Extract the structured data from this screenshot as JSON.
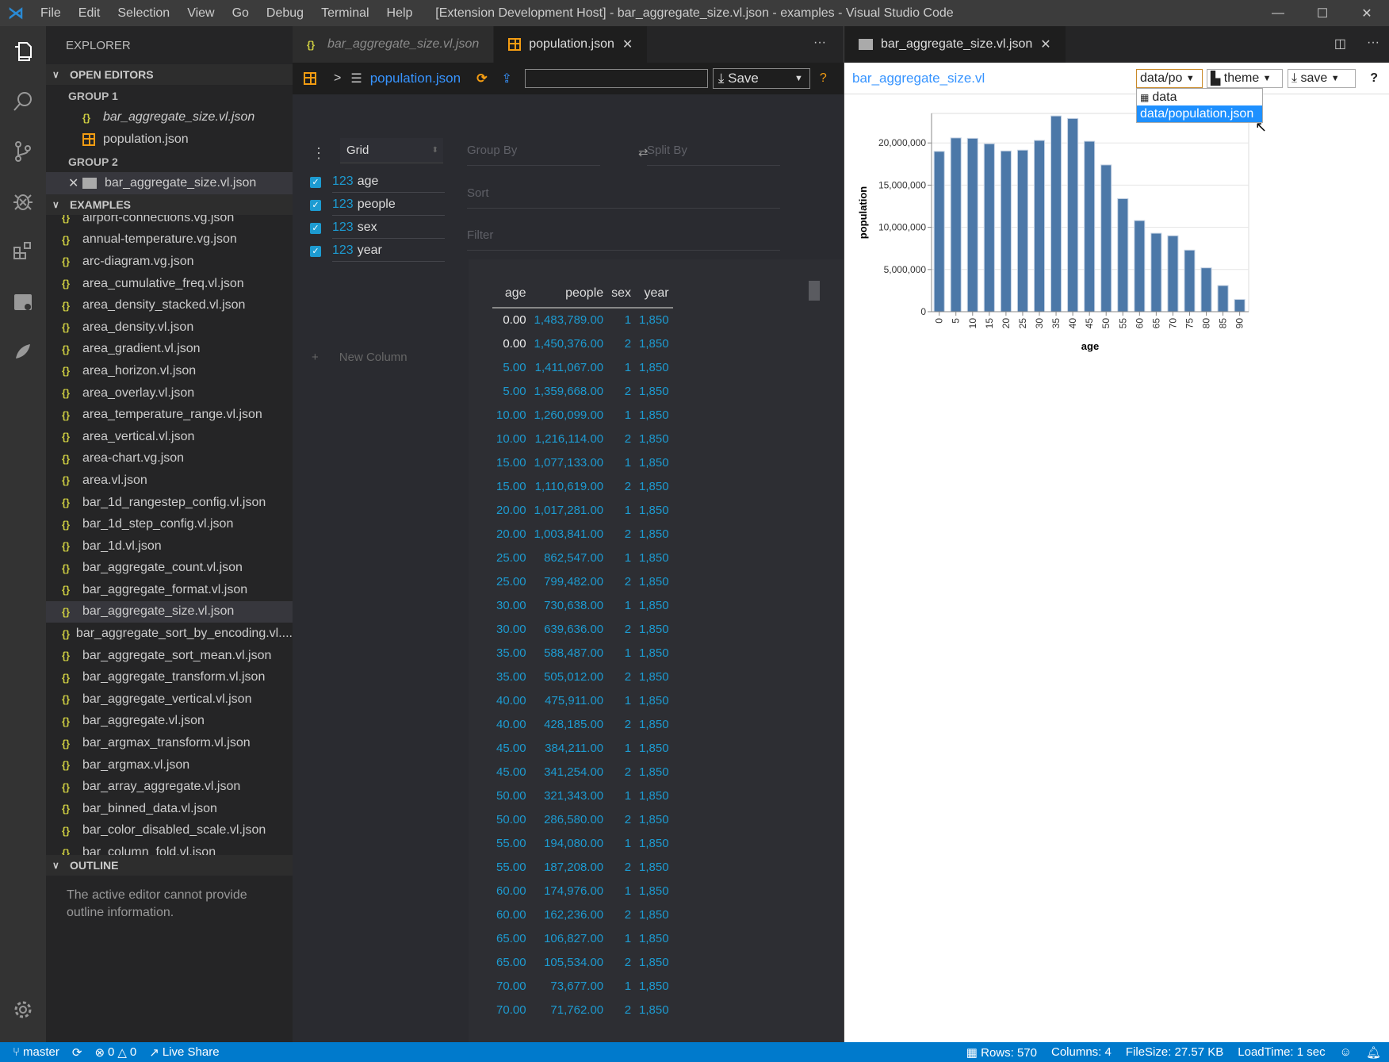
{
  "window": {
    "title": "[Extension Development Host] - bar_aggregate_size.vl.json - examples - Visual Studio Code",
    "menu": [
      "File",
      "Edit",
      "Selection",
      "View",
      "Go",
      "Debug",
      "Terminal",
      "Help"
    ],
    "controls": {
      "minimize": "—",
      "maximize": "☐",
      "close": "✕"
    }
  },
  "activity_bar": [
    "files-icon",
    "search-icon",
    "source-control-icon",
    "debug-icon",
    "extensions-icon",
    "live-share-icon",
    "rocket-icon"
  ],
  "sidebar": {
    "title": "EXPLORER",
    "open_editors": {
      "label": "OPEN EDITORS",
      "groups": [
        {
          "label": "GROUP 1",
          "items": [
            {
              "name": "bar_aggregate_size.vl.json",
              "icon": "braces"
            },
            {
              "name": "population.json",
              "icon": "table"
            }
          ]
        },
        {
          "label": "GROUP 2",
          "items": [
            {
              "name": "bar_aggregate_size.vl.json",
              "icon": "chart"
            }
          ]
        }
      ]
    },
    "examples": {
      "label": "EXAMPLES",
      "items": [
        "airport-connections.vg.json",
        "annual-temperature.vg.json",
        "arc-diagram.vg.json",
        "area_cumulative_freq.vl.json",
        "area_density_stacked.vl.json",
        "area_density.vl.json",
        "area_gradient.vl.json",
        "area_horizon.vl.json",
        "area_overlay.vl.json",
        "area_temperature_range.vl.json",
        "area_vertical.vl.json",
        "area-chart.vg.json",
        "area.vl.json",
        "bar_1d_rangestep_config.vl.json",
        "bar_1d_step_config.vl.json",
        "bar_1d.vl.json",
        "bar_aggregate_count.vl.json",
        "bar_aggregate_format.vl.json",
        "bar_aggregate_size.vl.json",
        "bar_aggregate_sort_by_encoding.vl....",
        "bar_aggregate_sort_mean.vl.json",
        "bar_aggregate_transform.vl.json",
        "bar_aggregate_vertical.vl.json",
        "bar_aggregate.vl.json",
        "bar_argmax_transform.vl.json",
        "bar_argmax.vl.json",
        "bar_array_aggregate.vl.json",
        "bar_binned_data.vl.json",
        "bar_color_disabled_scale.vl.json",
        "bar_column_fold.vl.json"
      ],
      "selected": "bar_aggregate_size.vl.json"
    },
    "outline": {
      "label": "OUTLINE",
      "message": "The active editor cannot provide outline information."
    }
  },
  "editor1": {
    "tabs": [
      {
        "label": "bar_aggregate_size.vl.json",
        "active": false
      },
      {
        "label": "population.json",
        "active": true
      }
    ],
    "toolbar": {
      "file": "population.json",
      "search_value": "",
      "save_label": "Save",
      "help": "?"
    },
    "perspective": {
      "view": "Grid",
      "group_by": "Group By",
      "split_by": "Split By",
      "sort": "Sort",
      "filter": "Filter",
      "columns": [
        {
          "type": "123",
          "name": "age"
        },
        {
          "type": "123",
          "name": "people"
        },
        {
          "type": "123",
          "name": "sex"
        },
        {
          "type": "123",
          "name": "year"
        }
      ],
      "new_column": "New Column",
      "table": {
        "headers": [
          "age",
          "people",
          "sex",
          "year"
        ],
        "rows": [
          [
            "0.00",
            "1,483,789.00",
            "1",
            "1,850"
          ],
          [
            "0.00",
            "1,450,376.00",
            "2",
            "1,850"
          ],
          [
            "5.00",
            "1,411,067.00",
            "1",
            "1,850"
          ],
          [
            "5.00",
            "1,359,668.00",
            "2",
            "1,850"
          ],
          [
            "10.00",
            "1,260,099.00",
            "1",
            "1,850"
          ],
          [
            "10.00",
            "1,216,114.00",
            "2",
            "1,850"
          ],
          [
            "15.00",
            "1,077,133.00",
            "1",
            "1,850"
          ],
          [
            "15.00",
            "1,110,619.00",
            "2",
            "1,850"
          ],
          [
            "20.00",
            "1,017,281.00",
            "1",
            "1,850"
          ],
          [
            "20.00",
            "1,003,841.00",
            "2",
            "1,850"
          ],
          [
            "25.00",
            "862,547.00",
            "1",
            "1,850"
          ],
          [
            "25.00",
            "799,482.00",
            "2",
            "1,850"
          ],
          [
            "30.00",
            "730,638.00",
            "1",
            "1,850"
          ],
          [
            "30.00",
            "639,636.00",
            "2",
            "1,850"
          ],
          [
            "35.00",
            "588,487.00",
            "1",
            "1,850"
          ],
          [
            "35.00",
            "505,012.00",
            "2",
            "1,850"
          ],
          [
            "40.00",
            "475,911.00",
            "1",
            "1,850"
          ],
          [
            "40.00",
            "428,185.00",
            "2",
            "1,850"
          ],
          [
            "45.00",
            "384,211.00",
            "1",
            "1,850"
          ],
          [
            "45.00",
            "341,254.00",
            "2",
            "1,850"
          ],
          [
            "50.00",
            "321,343.00",
            "1",
            "1,850"
          ],
          [
            "50.00",
            "286,580.00",
            "2",
            "1,850"
          ],
          [
            "55.00",
            "194,080.00",
            "1",
            "1,850"
          ],
          [
            "55.00",
            "187,208.00",
            "2",
            "1,850"
          ],
          [
            "60.00",
            "174,976.00",
            "1",
            "1,850"
          ],
          [
            "60.00",
            "162,236.00",
            "2",
            "1,850"
          ],
          [
            "65.00",
            "106,827.00",
            "1",
            "1,850"
          ],
          [
            "65.00",
            "105,534.00",
            "2",
            "1,850"
          ],
          [
            "70.00",
            "73,677.00",
            "1",
            "1,850"
          ],
          [
            "70.00",
            "71,762.00",
            "2",
            "1,850"
          ]
        ]
      }
    }
  },
  "editor2": {
    "tab": "bar_aggregate_size.vl.json",
    "toolbar": {
      "title": "bar_aggregate_size.vl",
      "data_select": "data/po",
      "theme_label": "theme",
      "save_label": "save",
      "help": "?"
    },
    "dropdown": [
      {
        "label": "data",
        "selected": false
      },
      {
        "label": "data/population.json",
        "selected": true
      }
    ]
  },
  "chart_data": {
    "type": "bar",
    "title": "",
    "xlabel": "age",
    "ylabel": "population",
    "categories": [
      "0",
      "5",
      "10",
      "15",
      "20",
      "25",
      "30",
      "35",
      "40",
      "45",
      "50",
      "55",
      "60",
      "65",
      "70",
      "75",
      "80",
      "85",
      "90"
    ],
    "values": [
      19000000,
      20600000,
      20550000,
      19900000,
      19050000,
      19150000,
      20300000,
      23200000,
      22900000,
      20200000,
      17400000,
      13400000,
      10800000,
      9300000,
      9000000,
      7300000,
      5200000,
      3100000,
      1450000
    ],
    "yticks": [
      "0",
      "5,000,000",
      "10,000,000",
      "15,000,000",
      "20,000,000"
    ],
    "ylim": [
      0,
      23500000
    ],
    "color": "#4c78a8",
    "grid": true
  },
  "statusbar": {
    "branch": "master",
    "errors": "0",
    "warnings": "0",
    "live_share": "Live Share",
    "rows": "Rows: 570",
    "columns": "Columns: 4",
    "filesize": "FileSize: 27.57 KB",
    "loadtime": "LoadTime: 1 sec"
  }
}
